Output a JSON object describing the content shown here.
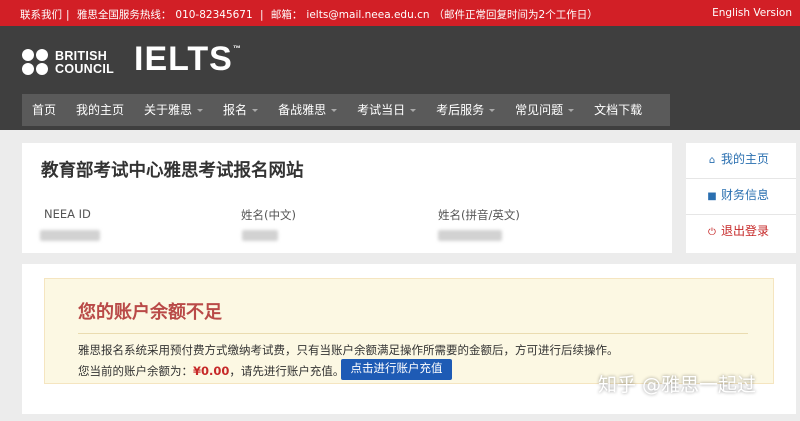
{
  "topbar": {
    "contact_prefix": "联系我们",
    "hotline_label": "雅思全国服务热线：",
    "hotline_number": "010-82345671",
    "email_label": "邮箱：",
    "email": "ielts@mail.neea.edu.cn",
    "email_note": "（邮件正常回复时间为2个工作日）",
    "language_link": "English Version"
  },
  "logos": {
    "british_council": "BRITISH\nCOUNCIL",
    "ielts": "IELTS",
    "ielts_tm": "™"
  },
  "nav": {
    "items": [
      {
        "label": "首页",
        "dropdown": false
      },
      {
        "label": "我的主页",
        "dropdown": false
      },
      {
        "label": "关于雅思",
        "dropdown": true
      },
      {
        "label": "报名",
        "dropdown": true
      },
      {
        "label": "备战雅思",
        "dropdown": true
      },
      {
        "label": "考试当日",
        "dropdown": true
      },
      {
        "label": "考后服务",
        "dropdown": true
      },
      {
        "label": "常见问题",
        "dropdown": true
      },
      {
        "label": "文档下载",
        "dropdown": false
      }
    ]
  },
  "info": {
    "title": "教育部考试中心雅思考试报名网站",
    "neea_id_label": "NEEA ID",
    "name_cn_label": "姓名(中文)",
    "name_en_label": "姓名(拼音/英文)"
  },
  "side": {
    "my_home": "我的主页",
    "finance": "财务信息",
    "logout": "退出登录",
    "my_home_icon": "home-icon",
    "finance_icon": "briefcase-icon",
    "logout_icon": "power-icon"
  },
  "alert": {
    "title": "您的账户余额不足",
    "line1": "雅思报名系统采用预付费方式缴纳考试费，只有当账户余额满足操作所需要的金额后，方可进行后续操作。",
    "balance_prefix": "您当前的账户余额为：",
    "balance": "¥0.00",
    "balance_suffix": "，请先进行账户充值。",
    "recharge_button": "点击进行账户充值"
  },
  "watermark": {
    "text": "知乎 @雅思一起过"
  },
  "colors": {
    "topbar": "#d21f26",
    "header": "#3f3f3f",
    "nav": "#5a5a5a",
    "alert_bg": "#fcf8e3",
    "alert_title": "#b94a48",
    "button": "#1e5bb5",
    "link_blue": "#2a6fb0",
    "danger_red": "#c62828"
  }
}
